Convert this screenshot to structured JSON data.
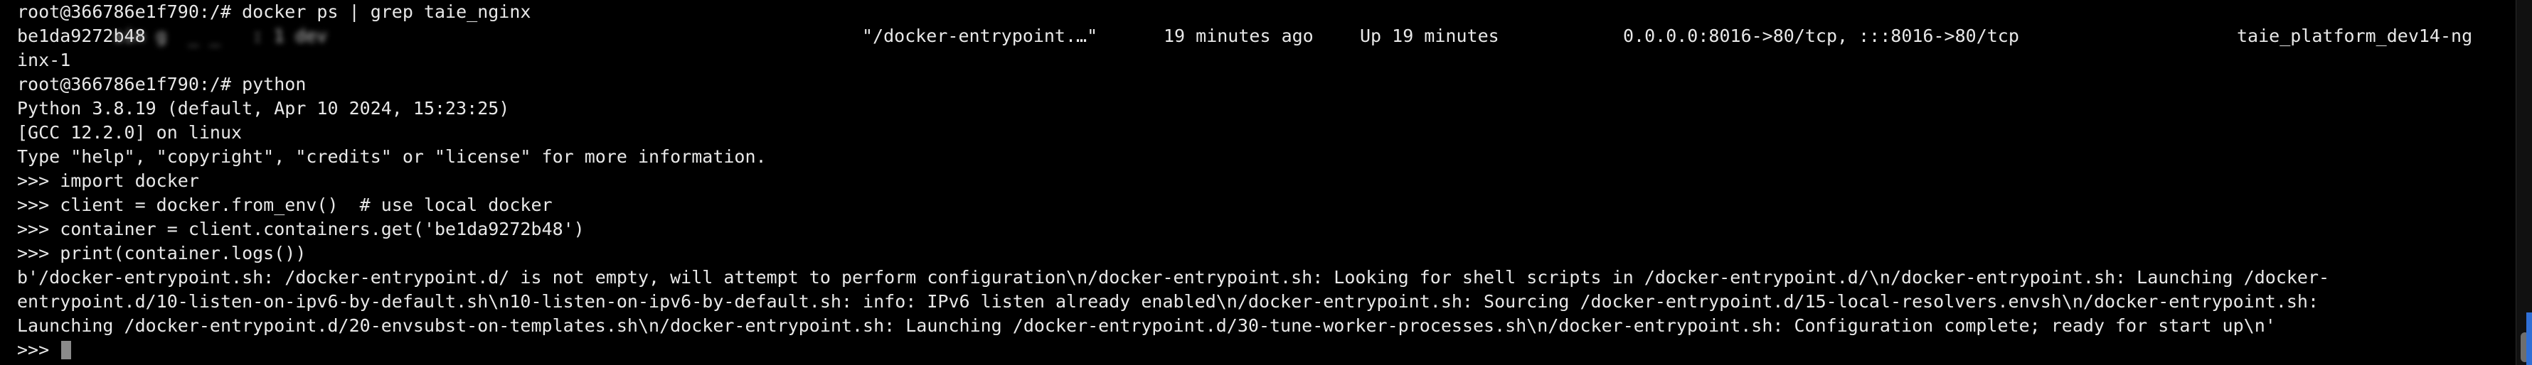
{
  "terminal": {
    "lines": [
      "root@366786e1f790:/# docker ps | grep taie_nginx"
    ],
    "ps_row": {
      "container_id": "be1da9272b48",
      "image": "sin g  _ _   : 1 dev",
      "command": "\"/docker-entrypoint.…\"",
      "created": "19 minutes ago",
      "status": "Up 19 minutes",
      "ports": "0.0.0.0:8016->80/tcp, :::8016->80/tcp",
      "name": "taie_platform_dev14-ng"
    },
    "wrap_line": "inx-1",
    "session": [
      "root@366786e1f790:/# python",
      "Python 3.8.19 (default, Apr 10 2024, 15:23:25)",
      "[GCC 12.2.0] on linux",
      "Type \"help\", \"copyright\", \"credits\" or \"license\" for more information.",
      ">>> import docker",
      ">>> client = docker.from_env()  # use local docker",
      ">>> container = client.containers.get('be1da9272b48')",
      ">>> print(container.logs())",
      "b'/docker-entrypoint.sh: /docker-entrypoint.d/ is not empty, will attempt to perform configuration\\n/docker-entrypoint.sh: Looking for shell scripts in /docker-entrypoint.d/\\n/docker-entrypoint.sh: Launching /docker-",
      "entrypoint.d/10-listen-on-ipv6-by-default.sh\\n10-listen-on-ipv6-by-default.sh: info: IPv6 listen already enabled\\n/docker-entrypoint.sh: Sourcing /docker-entrypoint.d/15-local-resolvers.envsh\\n/docker-entrypoint.sh:",
      "Launching /docker-entrypoint.d/20-envsubst-on-templates.sh\\n/docker-entrypoint.sh: Launching /docker-entrypoint.d/30-tune-worker-processes.sh\\n/docker-entrypoint.sh: Configuration complete; ready for start up\\n'"
    ],
    "prompt": ">>> "
  },
  "colors": {
    "background": "#000000",
    "foreground": "#e8e8e8",
    "cursor": "#8a8a8a",
    "scrollbar_accent": "#2f6fd6"
  }
}
